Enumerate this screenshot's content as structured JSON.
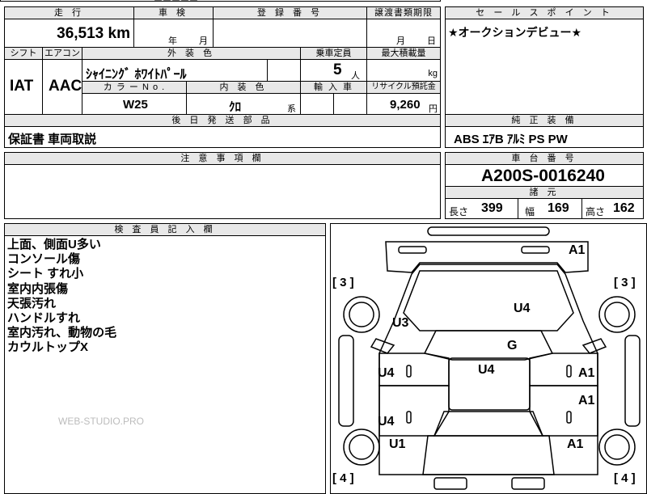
{
  "sheet": {
    "top_cut_text": "ーーーーー",
    "mileage_header": "走 行",
    "mileage_value": "36,513 km",
    "inspection_header": "車 検",
    "inspection_year_label": "年",
    "inspection_month_label": "月",
    "registration_header": "登 録 番 号",
    "transfer_header": "譲渡書類期限",
    "transfer_month_label": "月",
    "transfer_day_label": "日",
    "sales_point_header": "セ ー ル ス ポ イ ン ト",
    "sales_point_text": "★オークションデビュー★",
    "shift_header": "シフト",
    "shift_value": "IAT",
    "ac_header": "エアコン",
    "ac_value": "AAC",
    "exterior_color_header": "外 装 色",
    "exterior_color_value": "ｼｬｲﾆﾝｸﾞ ﾎﾜｲﾄﾊﾟｰﾙ",
    "capacity_header": "乗車定員",
    "capacity_value": "5",
    "capacity_unit": "人",
    "max_load_header": "最大積載量",
    "max_load_unit": "kg",
    "color_no_header": "カ ラ ー  N o .",
    "color_no_value": "W25",
    "interior_color_header": "内 装 色",
    "interior_color_value": "ｸﾛ",
    "interior_color_suffix": "系",
    "import_header": "輸 入 車",
    "recycle_header": "リサイクル預託金",
    "recycle_value": "9,260",
    "recycle_unit": "円",
    "later_parts_header": "後 日 発 送 部 品",
    "later_parts_text": "保証書  車両取説",
    "equipment_header": "純 正 装 備",
    "equipment_text": "ABS  ｴｱB  ｱﾙﾐ  PS  PW",
    "notes_header": "注 意 事 項 欄",
    "chassis_header": "車 台 番 号",
    "chassis_value": "A200S-0016240",
    "specs_header": "諸 元",
    "length_label": "長さ",
    "length_value": "399",
    "width_label": "幅",
    "width_value": "169",
    "height_label": "高さ",
    "height_value": "162",
    "inspector_header": "検 査 員 記 入 欄",
    "inspector_notes": [
      "上面、側面U多い",
      "コンソール傷",
      "シート すれ小",
      "室内内張傷",
      "天張汚れ",
      "ハンドルすれ",
      "室内汚れ、動物の毛",
      "カウルトップX"
    ],
    "watermark": "WEB-STUDIO.PRO"
  },
  "diagram": {
    "marks": {
      "a1_top": "A1",
      "u4_hood": "U4",
      "u3_left": "U3",
      "g_glass": "G",
      "u4_roof": "U4",
      "u4_left_front_door": "U4",
      "a1_right_front_door": "A1",
      "a1_right_rear_door": "A1",
      "u4_left_rear_door": "U4",
      "u1_left_rear": "U1",
      "a1_right_rear": "A1"
    },
    "tires": {
      "front_left": "[ 3 ]",
      "front_right": "[ 3 ]",
      "rear_left": "[ 4 ]",
      "rear_right": "[ 4 ]"
    }
  }
}
